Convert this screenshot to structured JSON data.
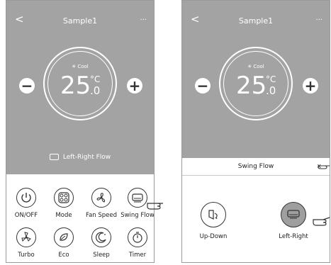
{
  "left": {
    "title": "Sample1",
    "back": "<",
    "more": "···",
    "mode": "✳ Cool",
    "temp_int": "25",
    "temp_unit": "°C",
    "temp_dec": ".0",
    "minus": "−",
    "plus": "+",
    "status": "Left-Right Flow",
    "buttons": [
      {
        "label": "ON/OFF",
        "icon": "power-icon"
      },
      {
        "label": "Mode",
        "icon": "mode-icon"
      },
      {
        "label": "Fan Speed",
        "icon": "fan-icon"
      },
      {
        "label": "Swing Flow",
        "icon": "swing-flow-icon"
      },
      {
        "label": "Turbo",
        "icon": "turbo-icon"
      },
      {
        "label": "Eco",
        "icon": "eco-icon"
      },
      {
        "label": "Sleep",
        "icon": "sleep-icon"
      },
      {
        "label": "Timer",
        "icon": "timer-icon"
      }
    ]
  },
  "right": {
    "title": "Sample1",
    "back": "<",
    "more": "···",
    "mode": "✳ Cool",
    "temp_int": "25",
    "temp_unit": "°C",
    "temp_dec": ".0",
    "minus": "−",
    "plus": "+",
    "panel_title": "Swing Flow",
    "close": "x",
    "options": [
      {
        "label": "Up-Down",
        "icon": "up-down-swing-icon"
      },
      {
        "label": "Left-Right",
        "icon": "left-right-swing-icon",
        "selected": true
      }
    ]
  }
}
